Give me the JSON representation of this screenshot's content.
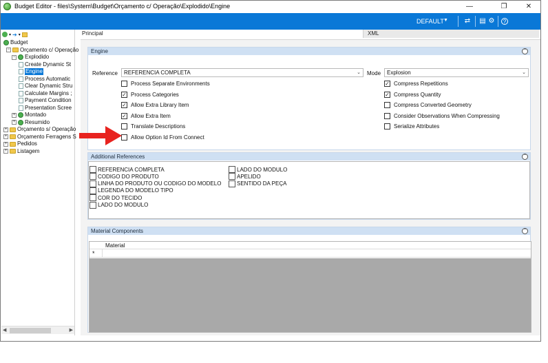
{
  "window": {
    "title": "Budget Editor - files\\System\\Budget\\Orçamento c/ Operação\\Explodido\\Engine",
    "minimize": "—",
    "maximize": "❐",
    "close": "✕"
  },
  "toolbar": {
    "profile": "DEFAULT",
    "profile_caret": "▼",
    "refresh_icon": "⇄",
    "layout_icon": "▤",
    "settings_icon": "⚙",
    "help_icon": "?"
  },
  "tree": {
    "toolbar_icons": [
      "add-icon",
      "dropdown-icon",
      "arrow-right-icon",
      "collapse-icon"
    ],
    "nodes": [
      {
        "label": "Budget",
        "icon": "gear",
        "expander": ""
      },
      {
        "label": "Orçamento c/ Operação",
        "icon": "folder",
        "expander": "−"
      },
      {
        "label": "Explodido",
        "icon": "gear",
        "expander": "−"
      },
      {
        "label": "Create Dynamic St",
        "icon": "page",
        "expander": ""
      },
      {
        "label": "Engine",
        "icon": "page",
        "expander": "",
        "selected": true
      },
      {
        "label": "Process Automatic",
        "icon": "page",
        "expander": ""
      },
      {
        "label": "Clear Dynamic Stru",
        "icon": "page",
        "expander": ""
      },
      {
        "label": "Calculate Margins ;",
        "icon": "page",
        "expander": ""
      },
      {
        "label": "Payment Condition",
        "icon": "page",
        "expander": ""
      },
      {
        "label": "Presentation Scree",
        "icon": "page",
        "expander": ""
      },
      {
        "label": "Montado",
        "icon": "gear",
        "expander": "+"
      },
      {
        "label": "Resumido",
        "icon": "gear",
        "expander": "+"
      },
      {
        "label": "Orçamento s/ Operação",
        "icon": "folder",
        "expander": "+"
      },
      {
        "label": "Orçamento Ferragens S",
        "icon": "folder",
        "expander": "+"
      },
      {
        "label": "Pedidos",
        "icon": "folder",
        "expander": "+"
      },
      {
        "label": "Listagem",
        "icon": "folder",
        "expander": "+"
      }
    ]
  },
  "tabs": {
    "principal": "Principal",
    "xml": "XML"
  },
  "engine": {
    "header": "Engine",
    "reference_label": "Reference",
    "reference_value": "REFERENCIA COMPLETA",
    "mode_label": "Mode",
    "mode_value": "Explosion",
    "left_options": [
      {
        "label": "Process Separate Environments",
        "checked": false
      },
      {
        "label": "Process Categories",
        "checked": true
      },
      {
        "label": "Allow Extra Library Item",
        "checked": true
      },
      {
        "label": "Allow Extra Item",
        "checked": true
      },
      {
        "label": "Translate Descriptions",
        "checked": false
      },
      {
        "label": "Allow Option Id From Connect",
        "checked": false
      }
    ],
    "right_options": [
      {
        "label": "Compress Repetitions",
        "checked": true
      },
      {
        "label": "Compress Quantity",
        "checked": true
      },
      {
        "label": "Compress Converted Geometry",
        "checked": false
      },
      {
        "label": "Consider Observations When Compressing",
        "checked": false
      },
      {
        "label": "Serialize Attributes",
        "checked": false
      }
    ]
  },
  "additional_references": {
    "header": "Additional References",
    "col1": [
      "REFERENCIA COMPLETA",
      "CODIGO DO PRODUTO",
      "LINHA DO PRODUTO OU CODIGO DO MODELO",
      "LEGENDA DO MODELO TIPO",
      "COR DO TECIDO",
      "LADO DO MODULO"
    ],
    "col2": [
      "LADO DO MODULO",
      "APELIDO",
      "SENTIDO DA PEÇA"
    ]
  },
  "material_components": {
    "header": "Material Components",
    "column": "Material",
    "row_marker": "*"
  },
  "colors": {
    "accent": "#0a78d7",
    "arrow": "#e8231f",
    "group_header": "#cfe0f3"
  }
}
